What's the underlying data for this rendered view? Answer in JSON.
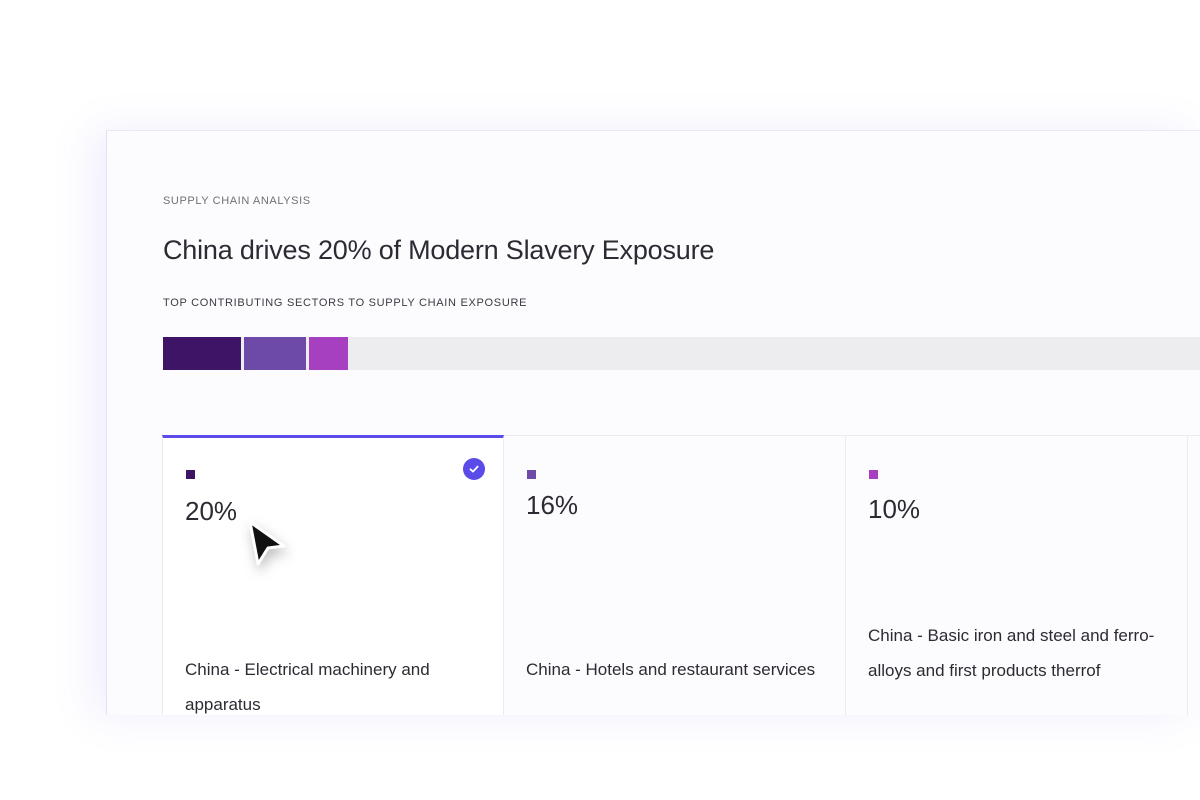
{
  "header": {
    "eyebrow": "SUPPLY CHAIN ANALYSIS",
    "title": "China drives 20% of Modern Slavery Exposure",
    "subhead": "TOP CONTRIBUTING SECTORS TO SUPPLY CHAIN EXPOSURE"
  },
  "exposure_bar": {
    "track_color": "#ededef",
    "segments": [
      {
        "value_fraction": 0.2,
        "color": "#3d1466"
      },
      {
        "value_fraction": 0.16,
        "color": "#6e4aa8"
      },
      {
        "value_fraction": 0.1,
        "color": "#a640c0"
      }
    ]
  },
  "cards": [
    {
      "percent": "20%",
      "label": "China - Electrical machinery and apparatus",
      "swatch_color": "#3d1466",
      "selected": true,
      "check_icon": "checkmark-icon"
    },
    {
      "percent": "16%",
      "label": "China - Hotels and restaurant services",
      "swatch_color": "#6e4aa8",
      "selected": false
    },
    {
      "percent": "10%",
      "label": "China - Basic iron and steel and ferro-alloys and first products therrof",
      "swatch_color": "#a640c0",
      "selected": false
    }
  ],
  "colors": {
    "accent": "#5b4be8",
    "text": "#2b2b33"
  },
  "pointer_icon": "cursor-arrow-icon"
}
